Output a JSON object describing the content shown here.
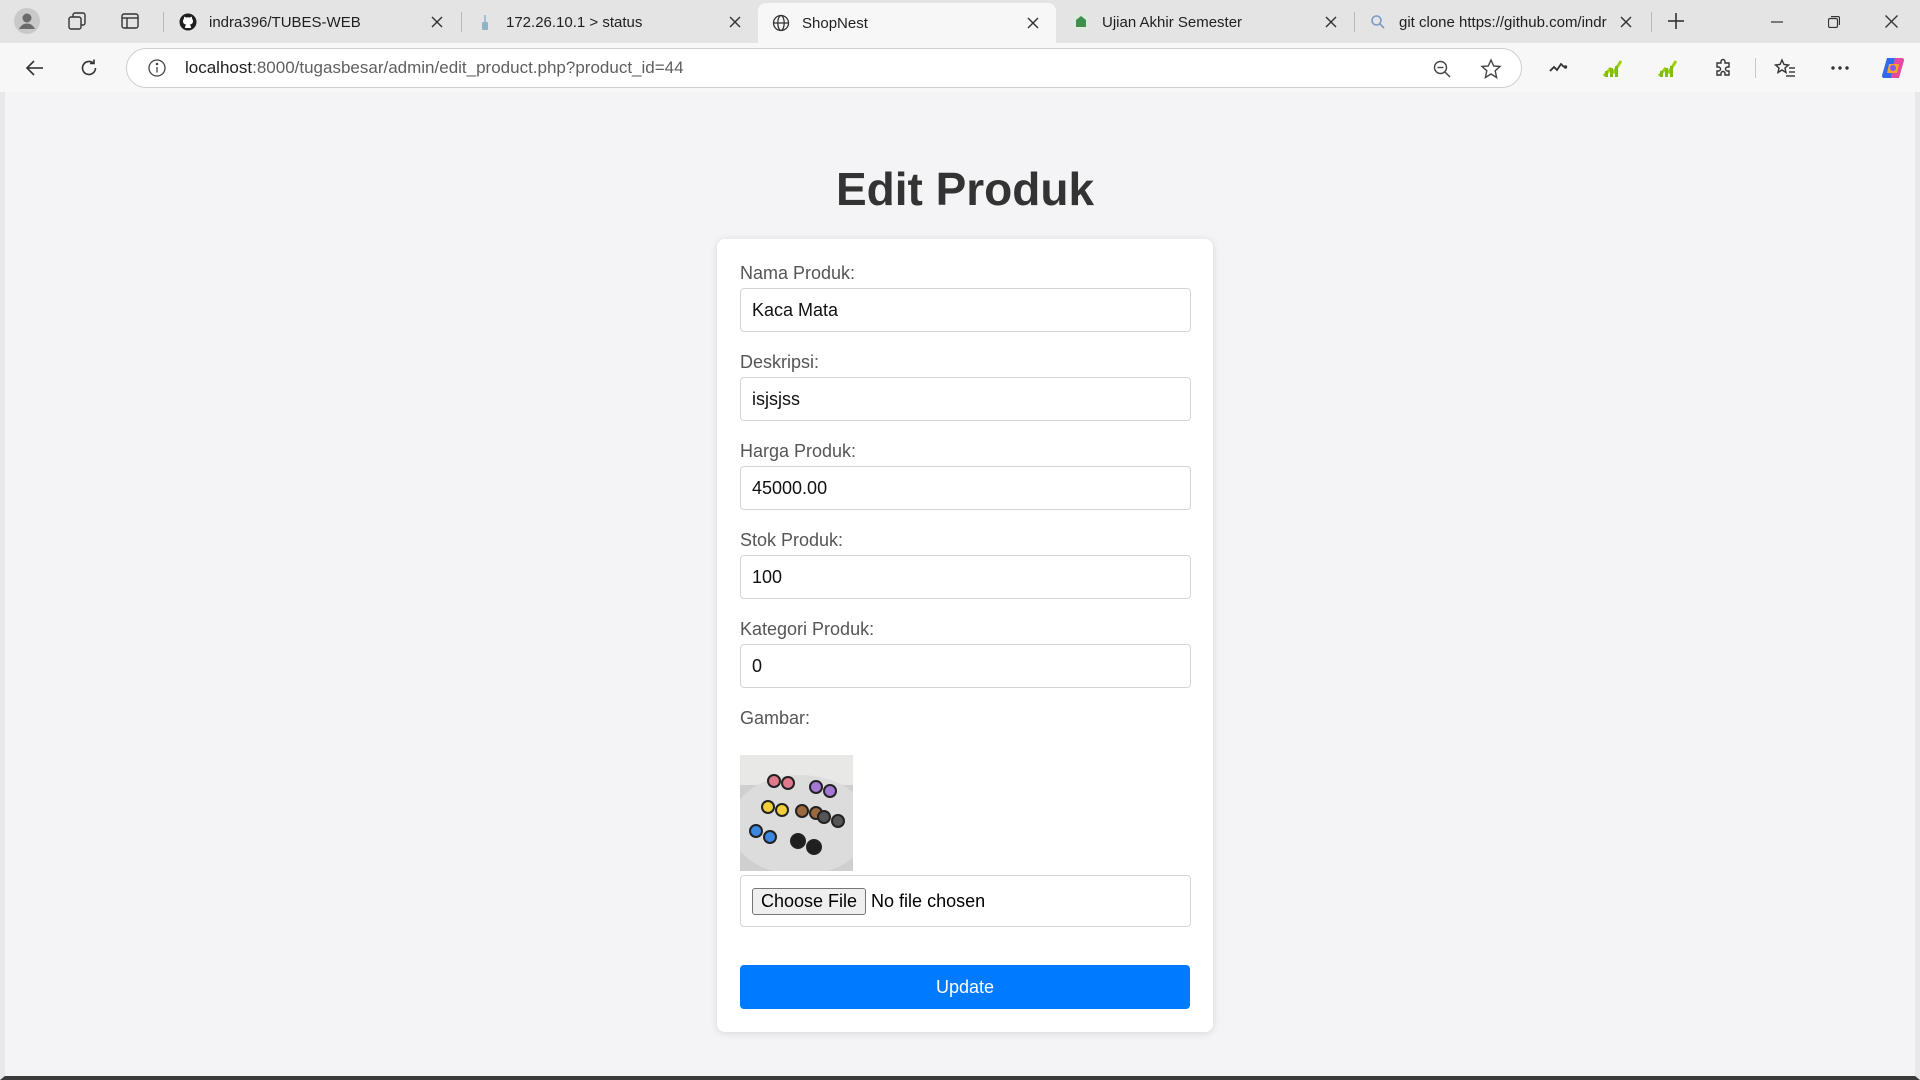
{
  "browser": {
    "tabs": [
      {
        "title": "indra396/TUBES-WEB",
        "icon": "github-icon"
      },
      {
        "title": "172.26.10.1 > status",
        "icon": "router-icon"
      },
      {
        "title": "ShopNest",
        "icon": "globe-icon",
        "active": true
      },
      {
        "title": "Ujian Akhir Semester",
        "icon": "school-icon"
      },
      {
        "title": "git clone https://github.com/indr",
        "icon": "search-icon"
      }
    ],
    "url_host": "localhost",
    "url_rest": ":8000/tugasbesar/admin/edit_product.php?product_id=44"
  },
  "page": {
    "title": "Edit Produk",
    "form": {
      "name_label": "Nama Produk:",
      "name_value": "Kaca Mata",
      "desc_label": "Deskripsi:",
      "desc_value": "isjsjss",
      "price_label": "Harga Produk:",
      "price_value": "45000.00",
      "stock_label": "Stok Produk:",
      "stock_value": "100",
      "category_label": "Kategori Produk:",
      "category_value": "0",
      "image_label": "Gambar:",
      "choose_file_label": "Choose File",
      "no_file_text": "No file chosen",
      "submit_label": "Update"
    }
  },
  "colors": {
    "primary_button": "#007bff",
    "page_background": "#f4f4f7",
    "card_background": "#ffffff"
  }
}
